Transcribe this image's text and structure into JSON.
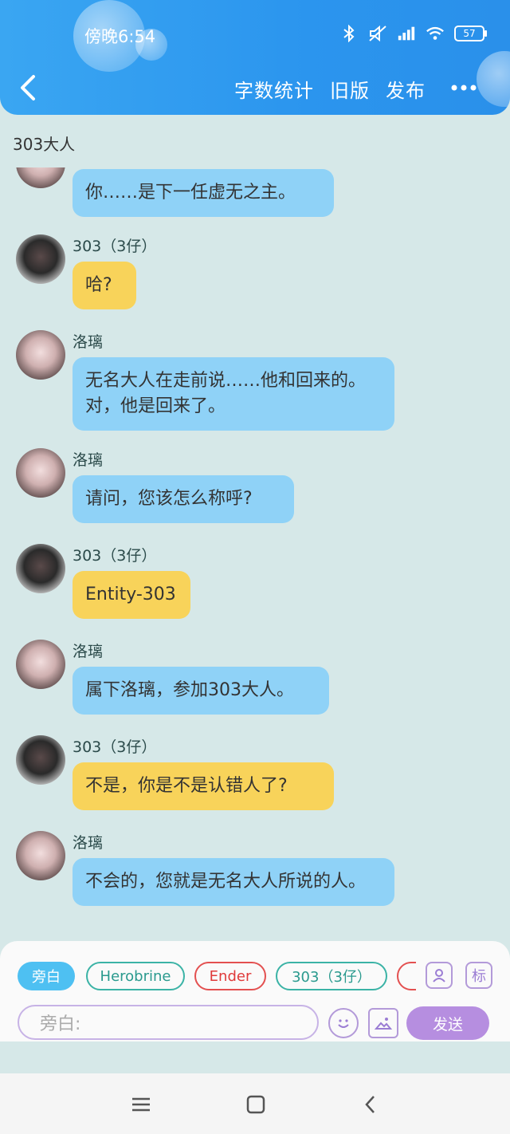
{
  "status": {
    "time": "傍晚6:54",
    "battery": "57"
  },
  "header": {
    "actions": [
      "字数统计",
      "旧版",
      "发布"
    ]
  },
  "chat": {
    "title": "303大人",
    "messages": [
      {
        "sender": "",
        "text": "你……是下一任虚无之主。",
        "color": "blue",
        "avatar": "luo"
      },
      {
        "sender": "303（3仔）",
        "text": "哈?",
        "color": "yellow",
        "avatar": "303"
      },
      {
        "sender": "洛璃",
        "text": "无名大人在走前说……他和回来的。对，他是回来了。",
        "color": "blue",
        "avatar": "luo"
      },
      {
        "sender": "洛璃",
        "text": "请问，您该怎么称呼?",
        "color": "blue",
        "avatar": "luo"
      },
      {
        "sender": "303（3仔）",
        "text": "Entity-303",
        "color": "yellow",
        "avatar": "303"
      },
      {
        "sender": "洛璃",
        "text": "属下洛璃，参加303大人。",
        "color": "blue",
        "avatar": "luo"
      },
      {
        "sender": "303（3仔）",
        "text": "不是，你是不是认错人了?",
        "color": "yellow",
        "avatar": "303"
      },
      {
        "sender": "洛璃",
        "text": "不会的，您就是无名大人所说的人。",
        "color": "blue",
        "avatar": "luo"
      }
    ]
  },
  "composer": {
    "chips": [
      "旁白",
      "Herobrine",
      "Ender",
      "303（3仔）"
    ],
    "side_buttons": [
      "标"
    ],
    "input_placeholder": "旁白:",
    "send_label": "发送"
  },
  "colors": {
    "header": "#2b95ee",
    "bubble_blue": "#8fd2f7",
    "bubble_yellow": "#f8d35a",
    "send": "#b68ee0"
  }
}
